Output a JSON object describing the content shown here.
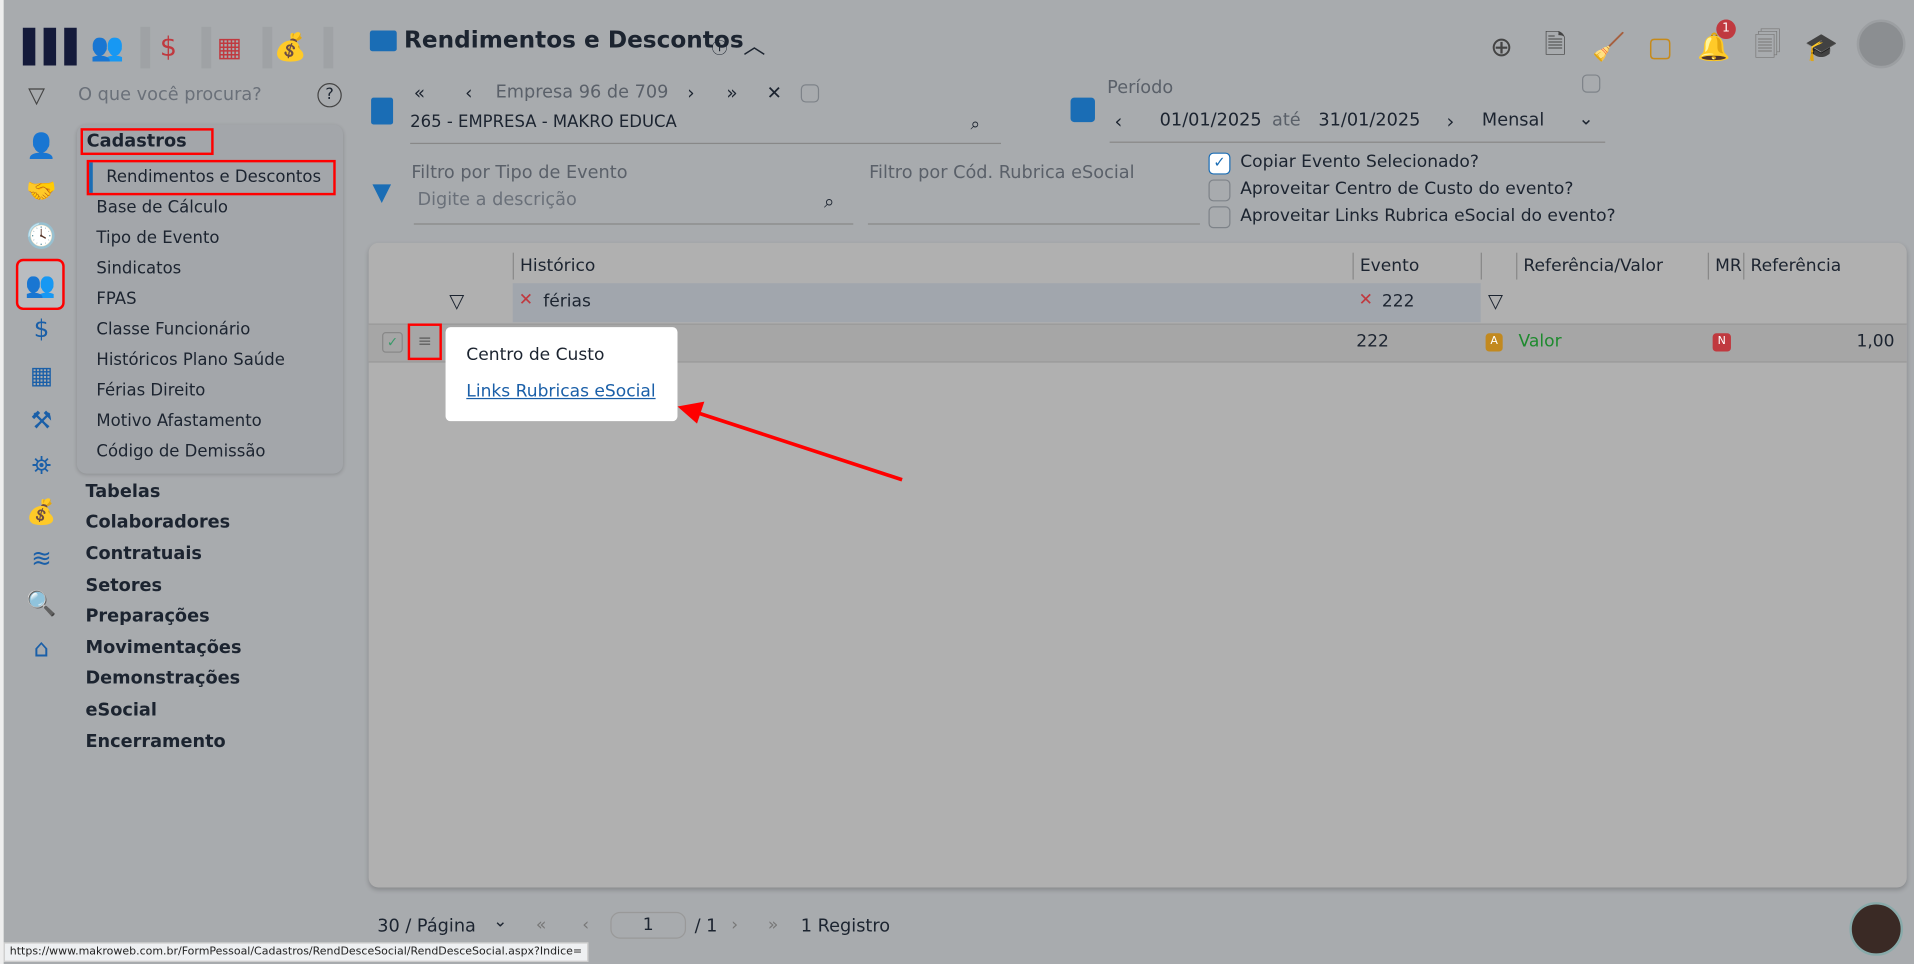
{
  "header": {
    "title": "Rendimentos e Descontos",
    "notification_count": "1"
  },
  "search": {
    "placeholder": "O que você procura?"
  },
  "menu": {
    "section": "Cadastros",
    "items": [
      "Rendimentos e Descontos",
      "Base de Cálculo",
      "Tipo de Evento",
      "Sindicatos",
      "FPAS",
      "Classe Funcionário",
      "Históricos Plano Saúde",
      "Férias Direito",
      "Motivo Afastamento",
      "Código de Demissão"
    ],
    "sections": [
      "Tabelas",
      "Colaboradores",
      "Contratuais",
      "Setores",
      "Preparações",
      "Movimentações",
      "Demonstrações",
      "eSocial",
      "Encerramento"
    ]
  },
  "empresa": {
    "nav": "Empresa 96 de 709",
    "value": "265 - EMPRESA - MAKRO EDUCA"
  },
  "periodo": {
    "label": "Período",
    "start": "01/01/2025",
    "sep": "até",
    "end": "31/01/2025",
    "type": "Mensal"
  },
  "filters": {
    "tipo_label": "Filtro por Tipo de Evento",
    "tipo_placeholder": "Digite a descrição",
    "rubrica_label": "Filtro por Cód. Rubrica eSocial"
  },
  "options": [
    {
      "label": "Copiar Evento Selecionado?",
      "checked": true
    },
    {
      "label": "Aproveitar Centro de Custo do evento?",
      "checked": false
    },
    {
      "label": "Aproveitar Links Rubrica eSocial do evento?",
      "checked": false
    }
  ],
  "grid": {
    "columns": [
      "Histórico",
      "Evento",
      "Referência/Valor",
      "MR",
      "Referência"
    ],
    "filter_historico": "férias",
    "filter_evento": "222",
    "row": {
      "evento": "222",
      "tipo_badge": "A",
      "ref_valor": "Valor",
      "mr_badge": "N",
      "referencia": "1,00"
    }
  },
  "context_menu": {
    "items": [
      "Centro de Custo",
      "Links Rubricas eSocial"
    ]
  },
  "pager": {
    "page_size": "30 / Página",
    "page": "1",
    "total_pages": "/ 1",
    "records": "1 Registro"
  },
  "status_url": "https://www.makroweb.com.br/FormPessoal/Cadastros/RendDesceSocial/RendDesceSocial.aspx?Indice="
}
